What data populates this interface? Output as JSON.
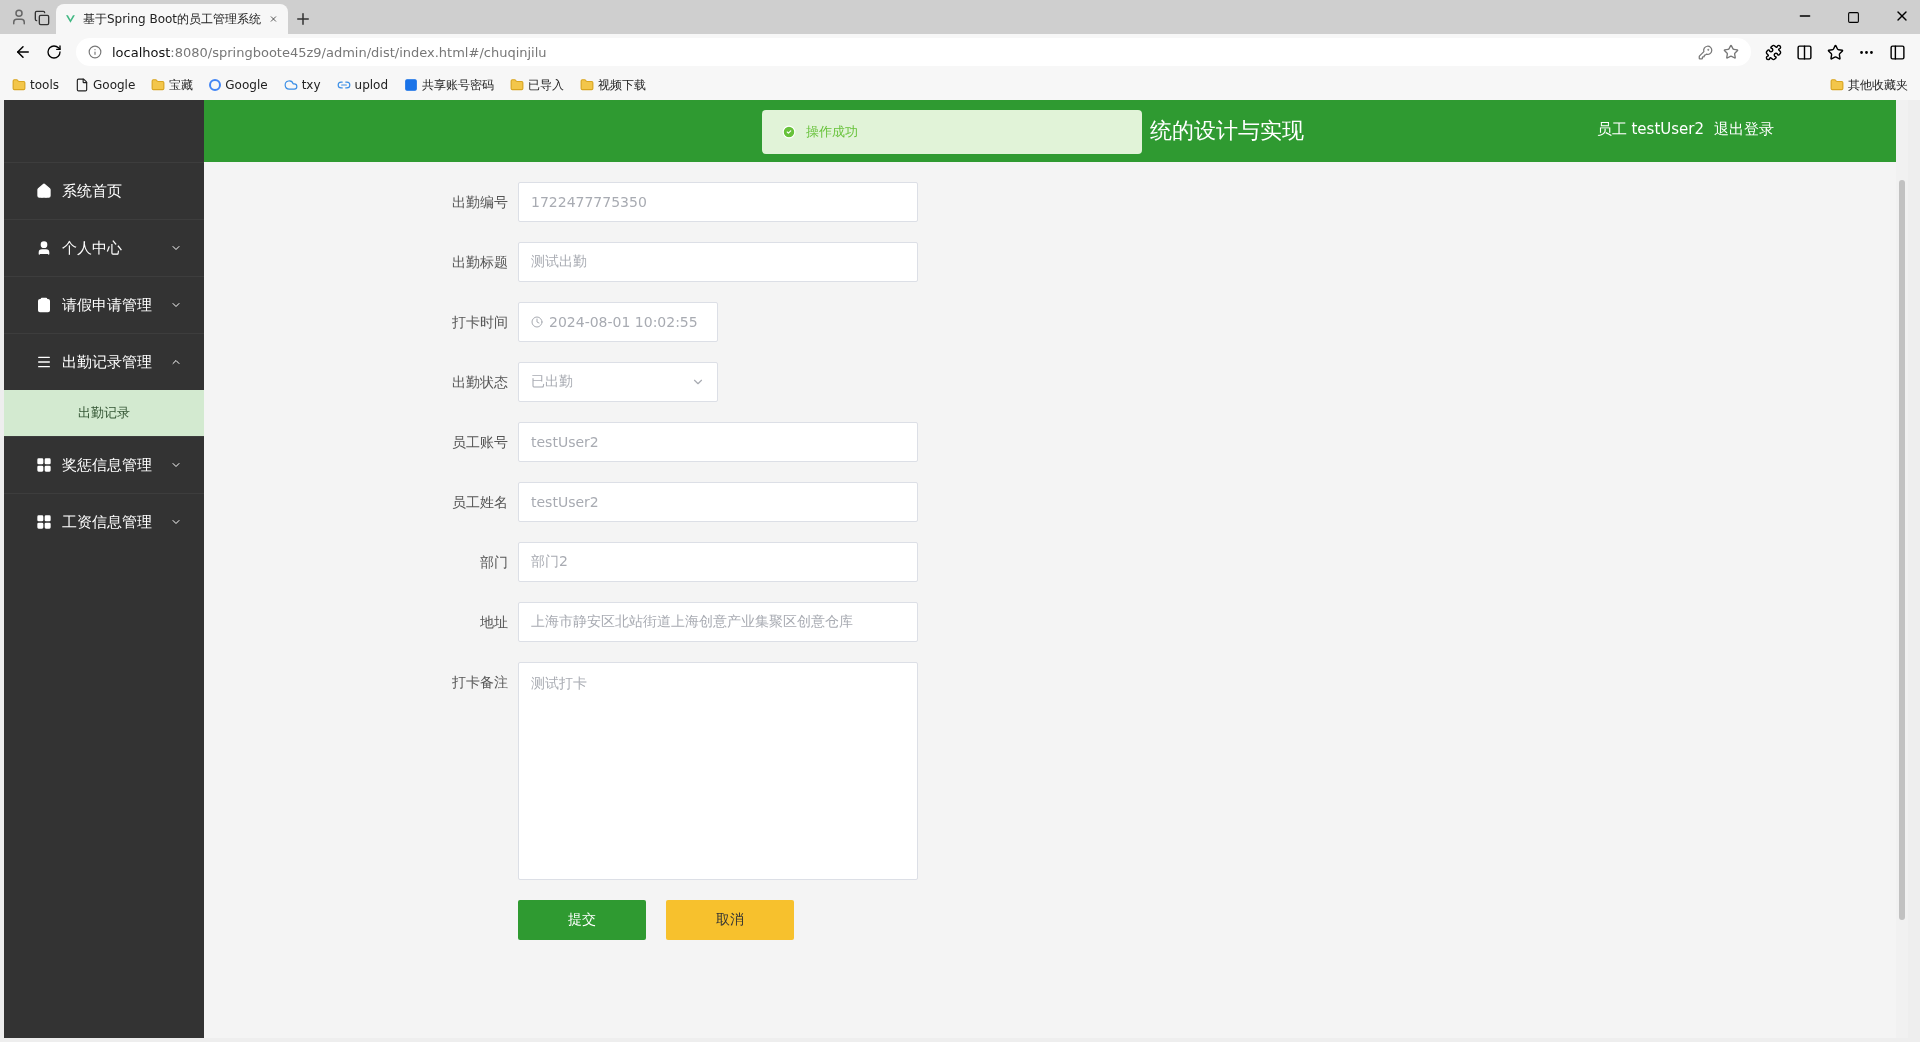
{
  "browser": {
    "tab_title": "基于Spring Boot的员工管理系统",
    "url_host": "localhost",
    "url_rest": ":8080/springboote45z9/admin/dist/index.html#/chuqinjilu",
    "bookmarks": [
      {
        "label": "tools",
        "kind": "folder"
      },
      {
        "label": "Google",
        "kind": "page"
      },
      {
        "label": "宝藏",
        "kind": "folder"
      },
      {
        "label": "Google",
        "kind": "google"
      },
      {
        "label": "txy",
        "kind": "cloud"
      },
      {
        "label": "uplod",
        "kind": "link"
      },
      {
        "label": "共享账号密码",
        "kind": "app"
      },
      {
        "label": "已导入",
        "kind": "folder"
      },
      {
        "label": "视频下载",
        "kind": "folder"
      }
    ],
    "other_bookmarks": "其他收藏夹"
  },
  "header": {
    "title": "统的设计与实现",
    "user": "员工 testUser2",
    "logout": "退出登录"
  },
  "toast": {
    "message": "操作成功"
  },
  "sidebar": {
    "items": [
      {
        "label": "系统首页",
        "kind": "link"
      },
      {
        "label": "个人中心",
        "kind": "menu",
        "expanded": false
      },
      {
        "label": "请假申请管理",
        "kind": "menu",
        "expanded": false
      },
      {
        "label": "出勤记录管理",
        "kind": "menu",
        "expanded": true,
        "children": [
          {
            "label": "出勤记录",
            "selected": true
          }
        ]
      },
      {
        "label": "奖惩信息管理",
        "kind": "menu",
        "expanded": false
      },
      {
        "label": "工资信息管理",
        "kind": "menu",
        "expanded": false
      }
    ]
  },
  "form": {
    "fields": [
      {
        "label": "出勤编号",
        "kind": "text",
        "value": "1722477775350"
      },
      {
        "label": "出勤标题",
        "kind": "text",
        "value": "测试出勤"
      },
      {
        "label": "打卡时间",
        "kind": "date",
        "value": "2024-08-01 10:02:55"
      },
      {
        "label": "出勤状态",
        "kind": "select",
        "value": "已出勤"
      },
      {
        "label": "员工账号",
        "kind": "text",
        "value": "testUser2"
      },
      {
        "label": "员工姓名",
        "kind": "text",
        "value": "testUser2"
      },
      {
        "label": "部门",
        "kind": "text",
        "value": "部门2"
      },
      {
        "label": "地址",
        "kind": "text",
        "value": "上海市静安区北站街道上海创意产业集聚区创意仓库"
      },
      {
        "label": "打卡备注",
        "kind": "textarea",
        "value": "测试打卡"
      }
    ],
    "buttons": [
      {
        "label": "提交",
        "kind": "primary"
      },
      {
        "label": "取消",
        "kind": "warning"
      }
    ]
  }
}
